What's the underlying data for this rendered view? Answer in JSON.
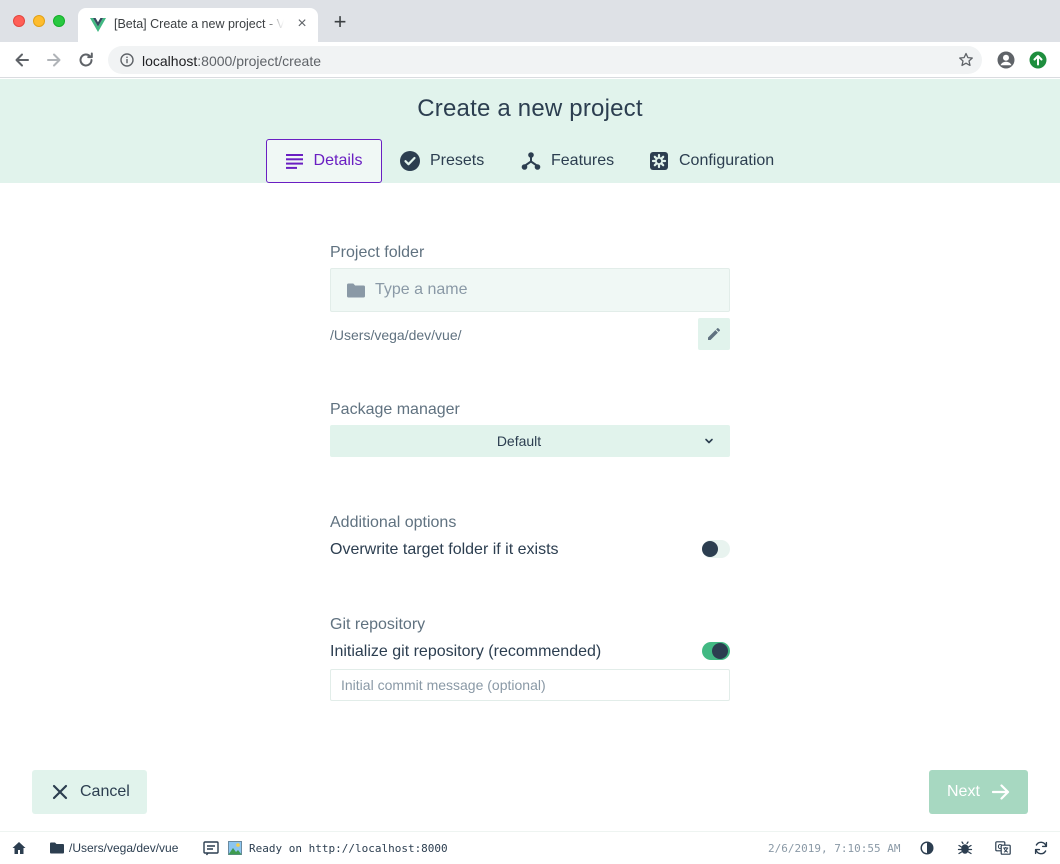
{
  "browser": {
    "tab_title": "[Beta] Create a new project - Vue UI",
    "url_host": "localhost",
    "url_rest": ":8000/project/create"
  },
  "header": {
    "title": "Create a new project",
    "tabs": [
      {
        "label": "Details",
        "icon": "details-icon",
        "active": true
      },
      {
        "label": "Presets",
        "icon": "check-circle-icon",
        "active": false
      },
      {
        "label": "Features",
        "icon": "fork-icon",
        "active": false
      },
      {
        "label": "Configuration",
        "icon": "gear-icon",
        "active": false
      }
    ]
  },
  "form": {
    "project_folder_label": "Project folder",
    "name_placeholder": "Type a name",
    "name_value": "",
    "path": "/Users/vega/dev/vue/",
    "package_manager_label": "Package manager",
    "package_manager_value": "Default",
    "additional_options_label": "Additional options",
    "overwrite_label": "Overwrite target folder if it exists",
    "overwrite_enabled": false,
    "git_label": "Git repository",
    "git_init_label": "Initialize git repository (recommended)",
    "git_init_enabled": true,
    "commit_placeholder": "Initial commit message (optional)"
  },
  "actions": {
    "cancel_label": "Cancel",
    "next_label": "Next"
  },
  "statusbar": {
    "cwd": "/Users/vega/dev/vue",
    "log": "Ready on http://localhost:8000",
    "timestamp": "2/6/2019, 7:10:55 AM"
  },
  "colors": {
    "accent_green": "#42b983",
    "header_bg": "#e1f3ec",
    "active_tab": "#6a1fc2",
    "text_dark": "#2c3e50"
  }
}
